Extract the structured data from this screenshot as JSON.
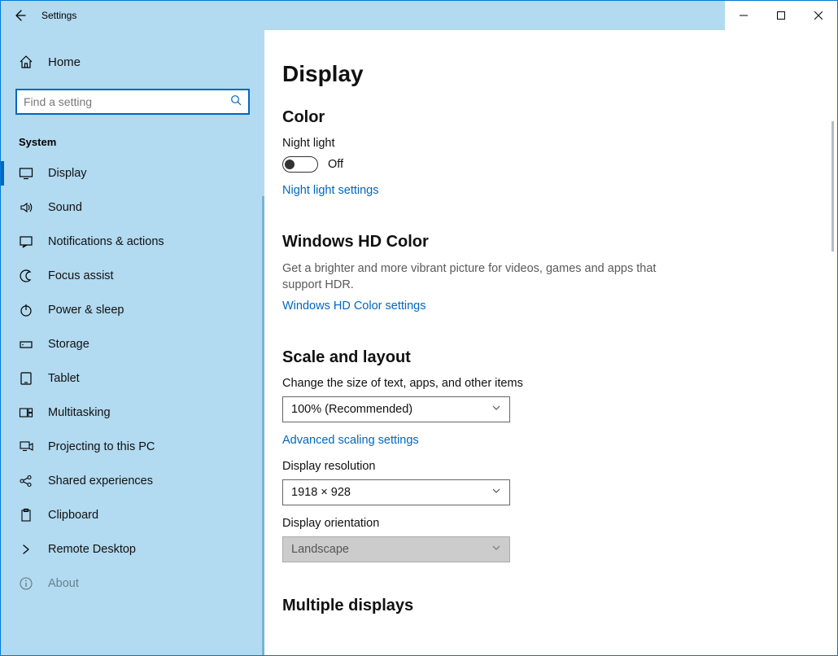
{
  "titlebar": {
    "title": "Settings"
  },
  "sidebar": {
    "home_label": "Home",
    "search_placeholder": "Find a setting",
    "section_label": "System",
    "items": [
      {
        "label": "Display"
      },
      {
        "label": "Sound"
      },
      {
        "label": "Notifications & actions"
      },
      {
        "label": "Focus assist"
      },
      {
        "label": "Power & sleep"
      },
      {
        "label": "Storage"
      },
      {
        "label": "Tablet"
      },
      {
        "label": "Multitasking"
      },
      {
        "label": "Projecting to this PC"
      },
      {
        "label": "Shared experiences"
      },
      {
        "label": "Clipboard"
      },
      {
        "label": "Remote Desktop"
      },
      {
        "label": "About"
      }
    ]
  },
  "main": {
    "page_title": "Display",
    "color_header": "Color",
    "night_light_label": "Night light",
    "night_light_state": "Off",
    "night_light_link": "Night light settings",
    "hd_header": "Windows HD Color",
    "hd_desc": "Get a brighter and more vibrant picture for videos, games and apps that support HDR.",
    "hd_link": "Windows HD Color settings",
    "scale_header": "Scale and layout",
    "scale_label": "Change the size of text, apps, and other items",
    "scale_value": "100% (Recommended)",
    "scale_link": "Advanced scaling settings",
    "res_label": "Display resolution",
    "res_value": "1918 × 928",
    "orient_label": "Display orientation",
    "orient_value": "Landscape",
    "multi_header": "Multiple displays"
  }
}
